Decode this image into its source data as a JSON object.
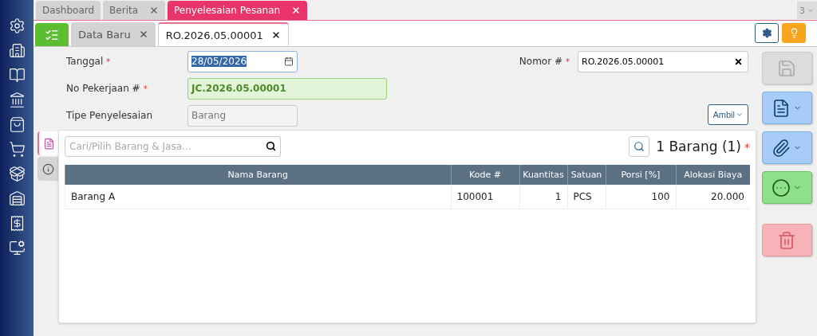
{
  "sidebar": {
    "items": [
      {
        "kind": "settings"
      },
      {
        "kind": "building"
      },
      {
        "kind": "book"
      },
      {
        "kind": "bank"
      },
      {
        "kind": "bag"
      },
      {
        "kind": "cart"
      },
      {
        "kind": "trolley"
      },
      {
        "kind": "warehouse"
      },
      {
        "kind": "tax"
      },
      {
        "kind": "report"
      }
    ]
  },
  "top_tabs": [
    {
      "label": "Dashboard",
      "selected": false,
      "closable": false
    },
    {
      "label": "Berita",
      "selected": false,
      "closable": true
    },
    {
      "label": "Penyelesaian Pesanan",
      "selected": true,
      "closable": true
    }
  ],
  "tab_count": "3",
  "sub_tabs": [
    {
      "label": "Data Baru",
      "selected": false
    },
    {
      "label": "RO.2026.05.00001",
      "selected": true
    }
  ],
  "form": {
    "left": [
      {
        "label": "Tanggal",
        "mark": "*",
        "kind": "date",
        "value": "28/05/2026"
      },
      {
        "label": "No Pekerjaan #",
        "mark": "*",
        "kind": "link",
        "value": "JC.2026.05.00001"
      },
      {
        "label": "Tipe Penyelesaian",
        "kind": "readonly",
        "value": "Barang"
      }
    ],
    "nomor": {
      "label": "Nomor #",
      "mark": "*",
      "value": "RO.2026.05.00001"
    },
    "ambil_button": "Ambil"
  },
  "panel": {
    "search": {
      "placeholder": "Cari/Pilih Barang & Jasa..."
    },
    "count": "1 Barang (1)",
    "mark": "*",
    "side_tabs": [
      {
        "kind": "detail",
        "selected": true
      },
      {
        "kind": "info",
        "selected": false
      }
    ],
    "table": {
      "columns": [
        "Nama Barang",
        "Kode #",
        "Kuantitas",
        "Satuan",
        "Porsi [%]",
        "Alokasi Biaya"
      ],
      "rows": [
        [
          "Barang A",
          "100001",
          "1",
          "PCS",
          "100",
          "20.000"
        ]
      ]
    }
  },
  "actions": [
    {
      "kind": "save",
      "disabled": true
    },
    {
      "kind": "document",
      "disabled": false
    },
    {
      "kind": "attach",
      "disabled": false
    },
    {
      "kind": "more",
      "disabled": false
    },
    {
      "kind": "delete",
      "disabled": false
    }
  ]
}
